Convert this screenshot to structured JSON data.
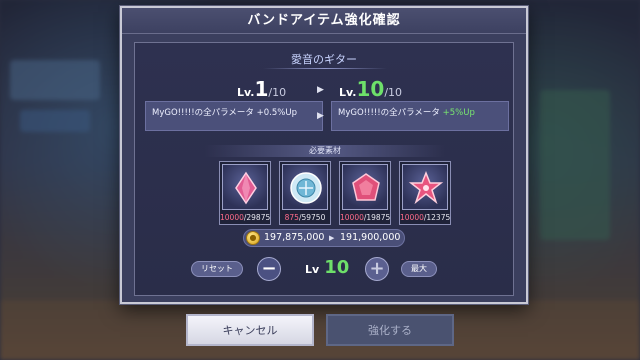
{
  "dialog": {
    "title": "バンドアイテム強化確認",
    "item_name": "愛音のギター"
  },
  "level": {
    "prefix": "Lv.",
    "from_value": "1",
    "from_max": "/10",
    "to_value": "10",
    "to_max": "/10"
  },
  "effects": {
    "from_text": "MyGO!!!!!の全パラメータ +0.5%Up",
    "to_prefix": "MyGO!!!!!の全パラメータ ",
    "to_highlight": "+5%Up"
  },
  "materials": {
    "header": "必要素材",
    "items": [
      {
        "name": "pink-crystal",
        "have": "10000",
        "need": "/29875",
        "color": "#e25c93"
      },
      {
        "name": "blue-seal",
        "have": "875",
        "need": "/59750",
        "color": "#6fb7d6"
      },
      {
        "name": "pink-gem",
        "have": "10000",
        "need": "/19875",
        "color": "#e0507a"
      },
      {
        "name": "pink-star",
        "have": "10000",
        "need": "/12375",
        "color": "#e8557f"
      }
    ]
  },
  "coins": {
    "from": "197,875,000",
    "to": "191,900,000"
  },
  "controls": {
    "reset_label": "リセット",
    "max_label": "最大",
    "lv_prefix": "Lv",
    "lv_value": "10",
    "minus": "−",
    "plus": "+"
  },
  "buttons": {
    "cancel_label": "キャンセル",
    "confirm_label": "強化する"
  },
  "colors": {
    "accent_green": "#6ee06a",
    "shortage_red": "#ff6b8a"
  }
}
